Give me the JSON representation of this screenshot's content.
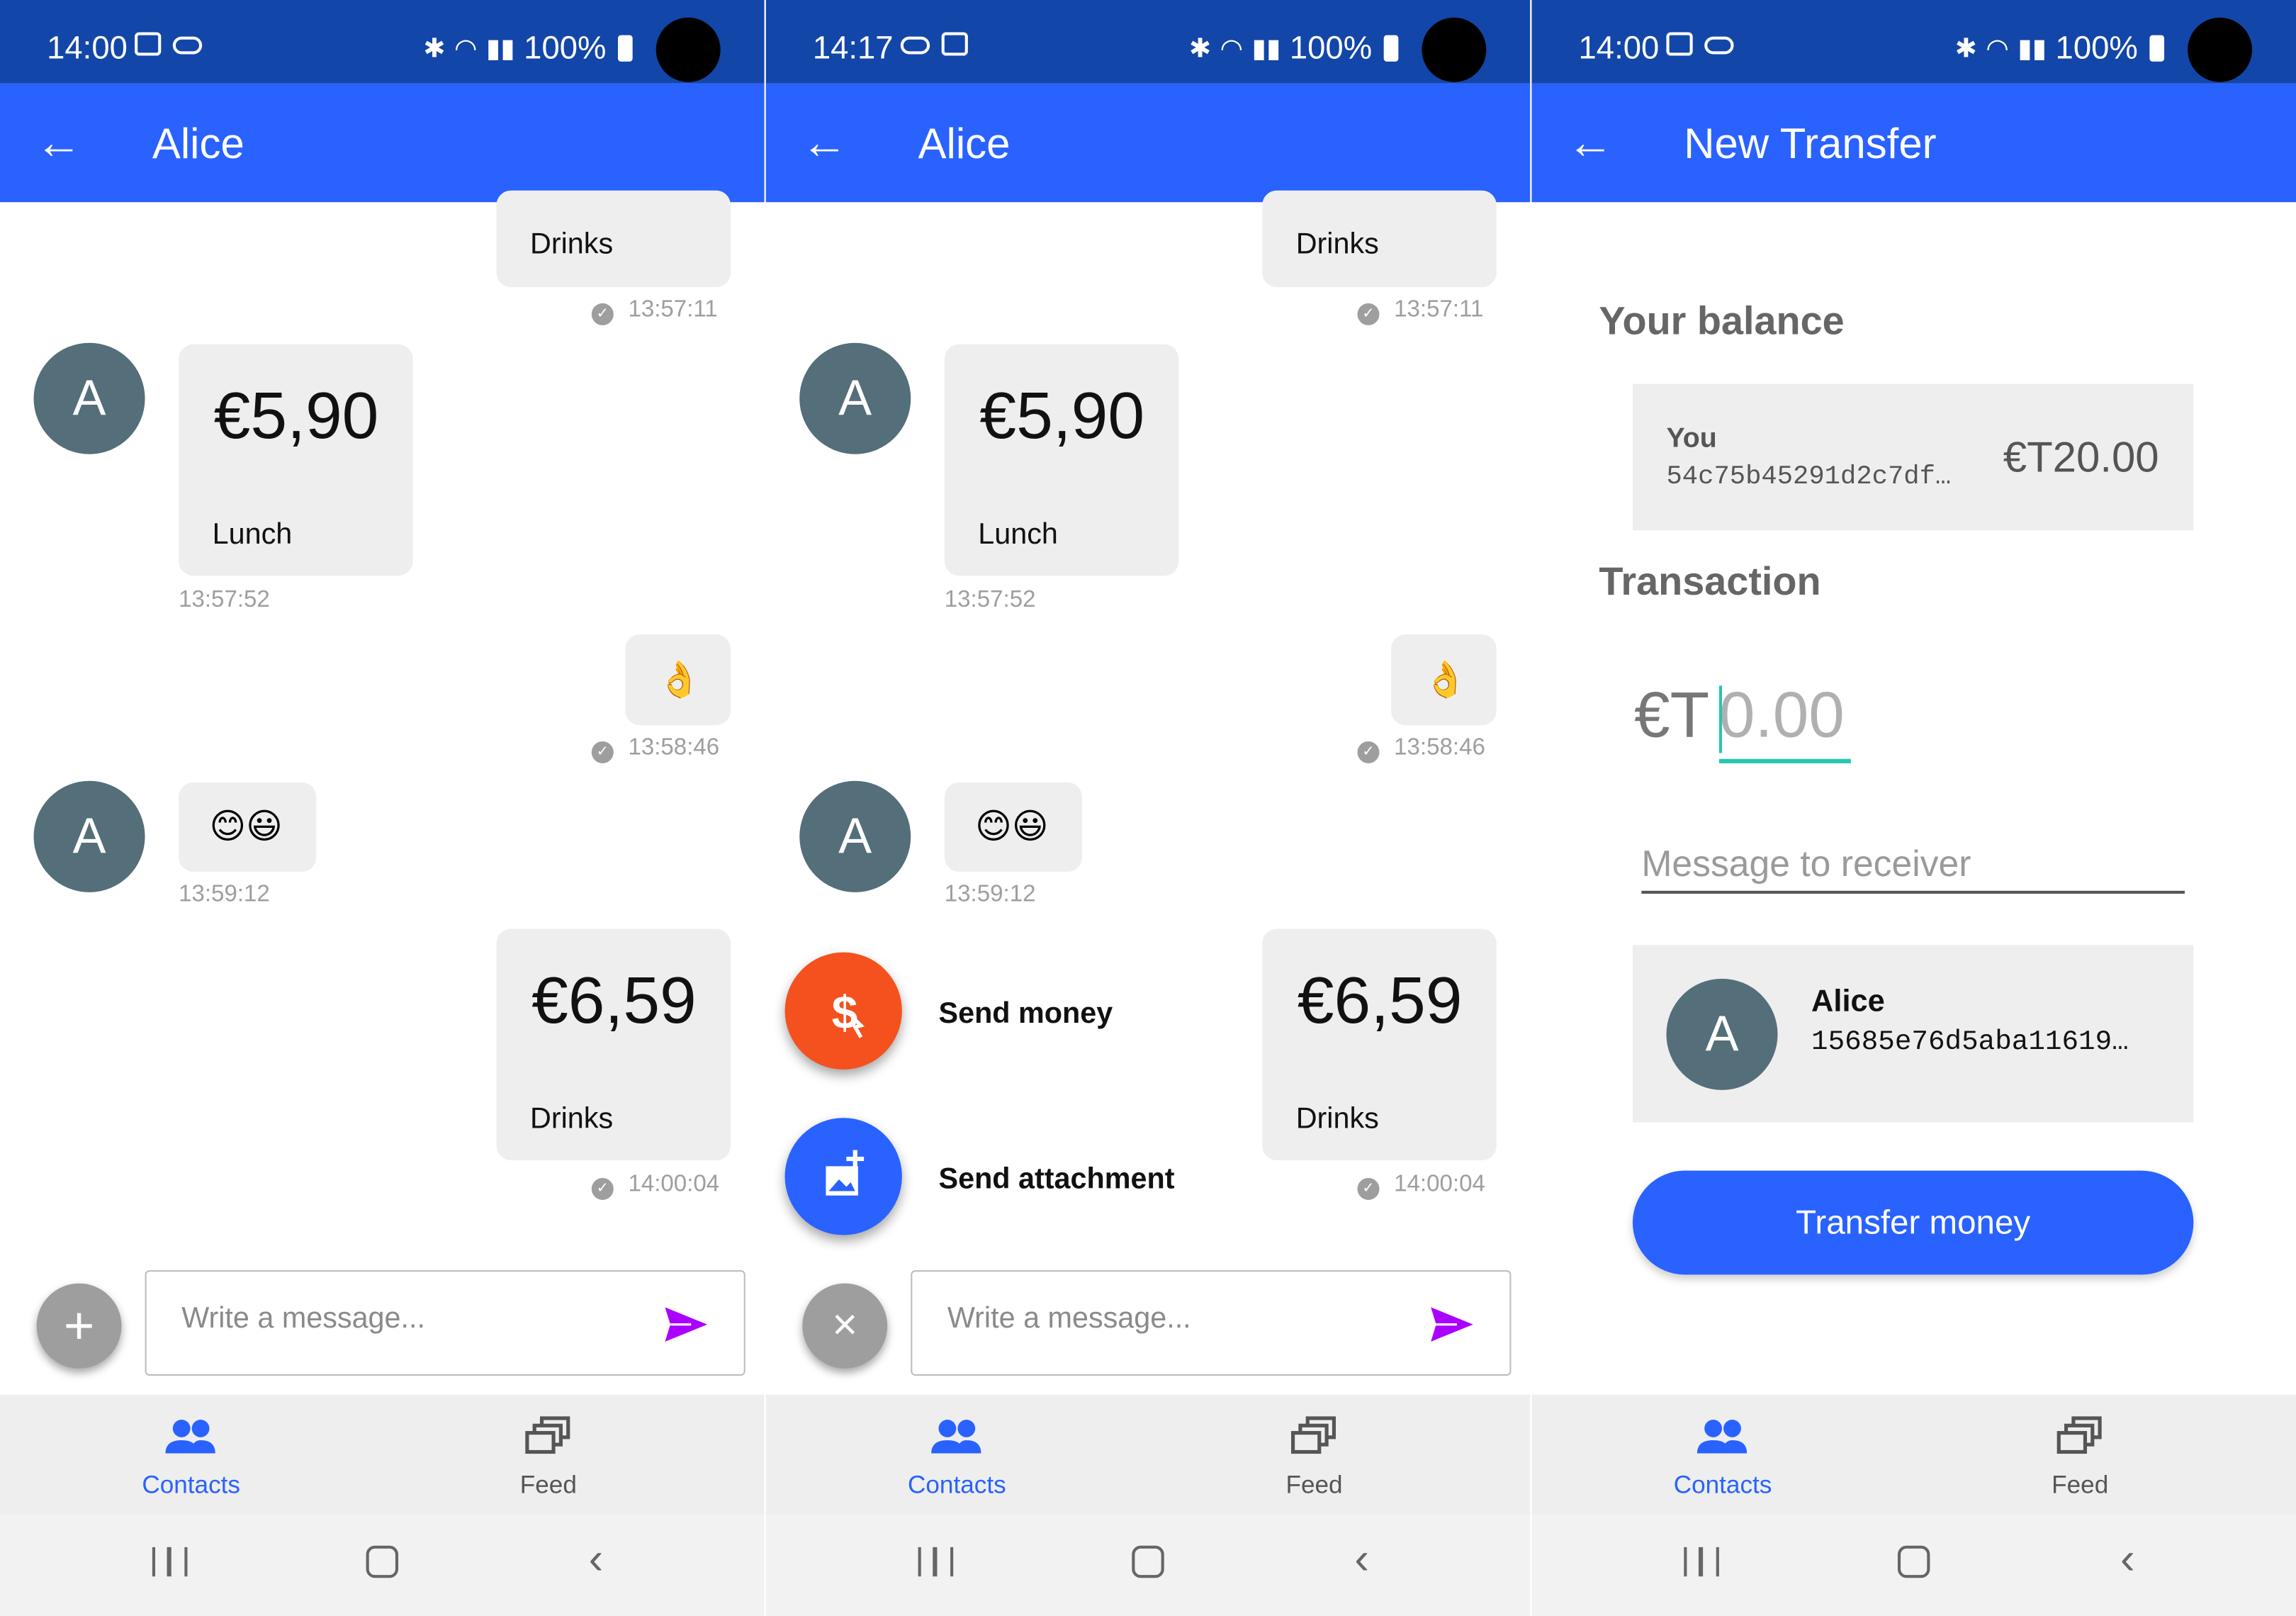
{
  "colors": {
    "status_bar": "#1246a8",
    "app_bar": "#2962ff",
    "accent": "#2962ff",
    "avatar": "#546e7a",
    "bubble": "#eeeeee",
    "send_money_fab": "#f4511e",
    "send_attachment_fab": "#2962ff",
    "cursor": "#26c6b0",
    "send_arrow": "#aa00ff"
  },
  "screens": [
    {
      "status": {
        "time": "14:00",
        "battery": "100%"
      },
      "title": "Alice",
      "messages": [
        {
          "desc": "Drinks",
          "time": "13:57:11"
        },
        {
          "avatar": "A",
          "amount": "€5,90",
          "desc": "Lunch",
          "time": "13:57:52"
        },
        {
          "emoji": "👌",
          "time": "13:58:46"
        },
        {
          "avatar": "A",
          "emoji": "😊😃",
          "time": "13:59:12"
        },
        {
          "amount": "€6,59",
          "desc": "Drinks",
          "time": "14:00:04"
        }
      ],
      "composer": {
        "placeholder": "Write a message...",
        "fab": "+"
      }
    },
    {
      "status": {
        "time": "14:17",
        "battery": "100%"
      },
      "title": "Alice",
      "messages": [
        {
          "desc": "Drinks",
          "time": "13:57:11"
        },
        {
          "avatar": "A",
          "amount": "€5,90",
          "desc": "Lunch",
          "time": "13:57:52"
        },
        {
          "emoji": "👌",
          "time": "13:58:46"
        },
        {
          "avatar": "A",
          "emoji": "😊😃",
          "time": "13:59:12"
        },
        {
          "amount": "€6,59",
          "desc": "Drinks",
          "time": "14:00:04"
        }
      ],
      "menu": {
        "send_money": "Send money",
        "send_attachment": "Send attachment"
      },
      "composer": {
        "placeholder": "Write a message...",
        "fab": "×"
      }
    },
    {
      "status": {
        "time": "14:00",
        "battery": "100%"
      },
      "title": "New Transfer",
      "balance": {
        "heading": "Your balance",
        "name": "You",
        "key": "54c75b45291d2c7df…",
        "amount": "€T20.00"
      },
      "transaction": {
        "heading": "Transaction",
        "currency": "€T",
        "amount_placeholder": "0.00",
        "message_placeholder": "Message to receiver"
      },
      "recipient": {
        "avatar": "A",
        "name": "Alice",
        "key": "15685e76d5aba11619…"
      },
      "button": "Transfer money"
    }
  ],
  "nav": {
    "contacts": "Contacts",
    "feed": "Feed"
  },
  "icons": {
    "back": "arrow-left-icon",
    "send": "send-arrow-icon",
    "contacts": "people-icon",
    "feed": "feed-cards-icon",
    "check": "check-circle-icon",
    "send_money": "dollar-hand-icon",
    "send_attachment": "add-photo-icon"
  }
}
